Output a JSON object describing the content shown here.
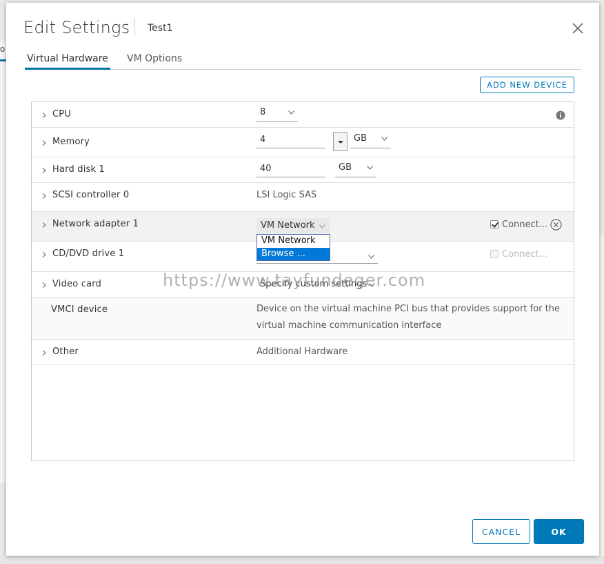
{
  "dialog": {
    "title": "Edit Settings",
    "vm_name": "Test1",
    "tabs": [
      {
        "label": "Virtual Hardware",
        "active": true
      },
      {
        "label": "VM Options",
        "active": false
      }
    ],
    "add_device_label": "ADD NEW DEVICE",
    "cancel_label": "CANCEL",
    "ok_label": "OK"
  },
  "hardware": {
    "cpu": {
      "label": "CPU",
      "value": "8"
    },
    "memory": {
      "label": "Memory",
      "value": "4",
      "unit": "GB"
    },
    "hard_disk": {
      "label": "Hard disk 1",
      "value": "40",
      "unit": "GB"
    },
    "scsi": {
      "label": "SCSI controller 0",
      "value": "LSI Logic SAS"
    },
    "network": {
      "label": "Network adapter 1",
      "value": "VM Network",
      "options": [
        "VM Network",
        "Browse ..."
      ],
      "highlighted_option": "Browse ...",
      "connect_label": "Connect...",
      "connected": true
    },
    "cd_dvd": {
      "label": "CD/DVD drive 1",
      "connect_label": "Connect...",
      "connected": false
    },
    "video": {
      "label": "Video card",
      "value": "Specify custom settings"
    },
    "vmci": {
      "label": "VMCI device",
      "description": "Device on the virtual machine PCI bus that provides support for the virtual machine communication interface"
    },
    "other": {
      "label": "Other",
      "value": "Additional Hardware"
    }
  },
  "watermark": "https://www.tayfundeger.com",
  "colors": {
    "accent": "#0079b8",
    "dropdown_highlight": "#0078d7"
  }
}
